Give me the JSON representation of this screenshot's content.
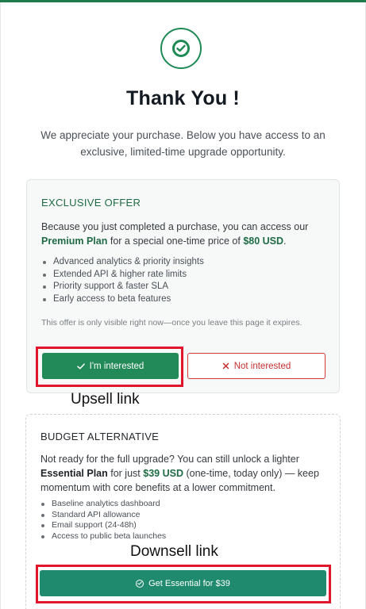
{
  "header": {
    "title": "Thank You !",
    "subtitle": "We appreciate your purchase. Below you have access to an exclusive, limited-time upgrade opportunity."
  },
  "offer": {
    "heading": "EXCLUSIVE OFFER",
    "lead_prefix": "Because you just completed a purchase, you can access our",
    "plan_name": "Premium Plan",
    "lead_middle": "for a special one-time price of",
    "price": "$80 USD",
    "lead_suffix": ".",
    "features": [
      "Advanced analytics & priority insights",
      "Extended API & higher rate limits",
      "Priority support & faster SLA",
      "Early access to beta features"
    ],
    "note": "This offer is only visible right now—once you leave this page it expires.",
    "interested_label": "I'm interested",
    "not_interested_label": "Not interested"
  },
  "budget": {
    "heading": "BUDGET ALTERNATIVE",
    "lead_prefix": "Not ready for the full upgrade? You can still unlock a lighter",
    "plan_name": "Essential Plan",
    "lead_middle": "for just",
    "price": "$39 USD",
    "lead_suffix": "(one-time, today only) — keep momentum with core benefits at a lower commitment.",
    "features": [
      "Baseline analytics dashboard",
      "Standard API allowance",
      "Email support (24-48h)",
      "Access to public beta launches"
    ],
    "button_label": "Get Essential for $39"
  },
  "annotations": {
    "upsell_label": "Upsell link",
    "downsell_label": "Downsell link",
    "highlight_color": "#e0172c"
  },
  "colors": {
    "brand_green": "#1f8a56",
    "heading_green": "#1f6b45",
    "decline_red": "#c62f2f",
    "essential_teal": "#1f8a6e"
  },
  "icons": {
    "success": "check-circle-icon",
    "accept": "checkmark-icon",
    "decline": "x-icon",
    "essential": "check-circle-icon"
  }
}
